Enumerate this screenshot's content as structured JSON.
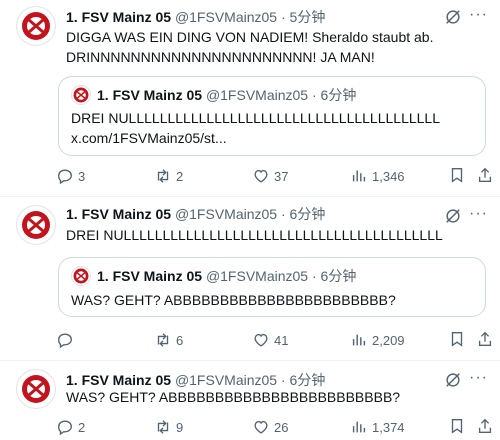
{
  "tweets": [
    {
      "name": "1. FSV Mainz 05",
      "handle": "@1FSVMainz05",
      "time": "· 5分钟",
      "text": "DIGGA WAS EIN DING VON NADIEM! Sheraldo staubt ab.\nDRINNNNNNNNNNNNNNNNNNNNNN! JA MAN!",
      "quote": {
        "name": "1. FSV Mainz 05",
        "handle": "@1FSVMainz05",
        "time": "· 6分钟",
        "text": "DREI NULLLLLLLLLLLLLLLLLLLLLLLLLLLLLLLLLLLLLLLL\nx.com/1FSVMainz05/st..."
      },
      "replies": "3",
      "reposts": "2",
      "likes": "37",
      "views": "1,346"
    },
    {
      "name": "1. FSV Mainz 05",
      "handle": "@1FSVMainz05",
      "time": "· 6分钟",
      "text": "DREI NULLLLLLLLLLLLLLLLLLLLLLLLLLLLLLLLLLLLLLLLL",
      "quote": {
        "name": "1. FSV Mainz 05",
        "handle": "@1FSVMainz05",
        "time": "· 6分钟",
        "text": "WAS? GEHT? ABBBBBBBBBBBBBBBBBBBBBBB?"
      },
      "replies": "",
      "reposts": "6",
      "likes": "41",
      "views": "2,209"
    },
    {
      "name": "1. FSV Mainz 05",
      "handle": "@1FSVMainz05",
      "time": "· 6分钟",
      "text": "WAS? GEHT? ABBBBBBBBBBBBBBBBBBBBBBBB?",
      "replies": "2",
      "reposts": "9",
      "likes": "26",
      "views": "1,374"
    }
  ],
  "icons": {
    "more": "more-icon",
    "grok": "grok-icon",
    "reply": "reply-icon",
    "repost": "repost-icon",
    "like": "heart-icon",
    "views": "views-icon",
    "bookmark": "bookmark-icon",
    "share": "share-icon"
  },
  "colors": {
    "brand_red": "#c3141e",
    "text": "#0f1419",
    "secondary": "#536471",
    "border": "#cfd9de"
  }
}
